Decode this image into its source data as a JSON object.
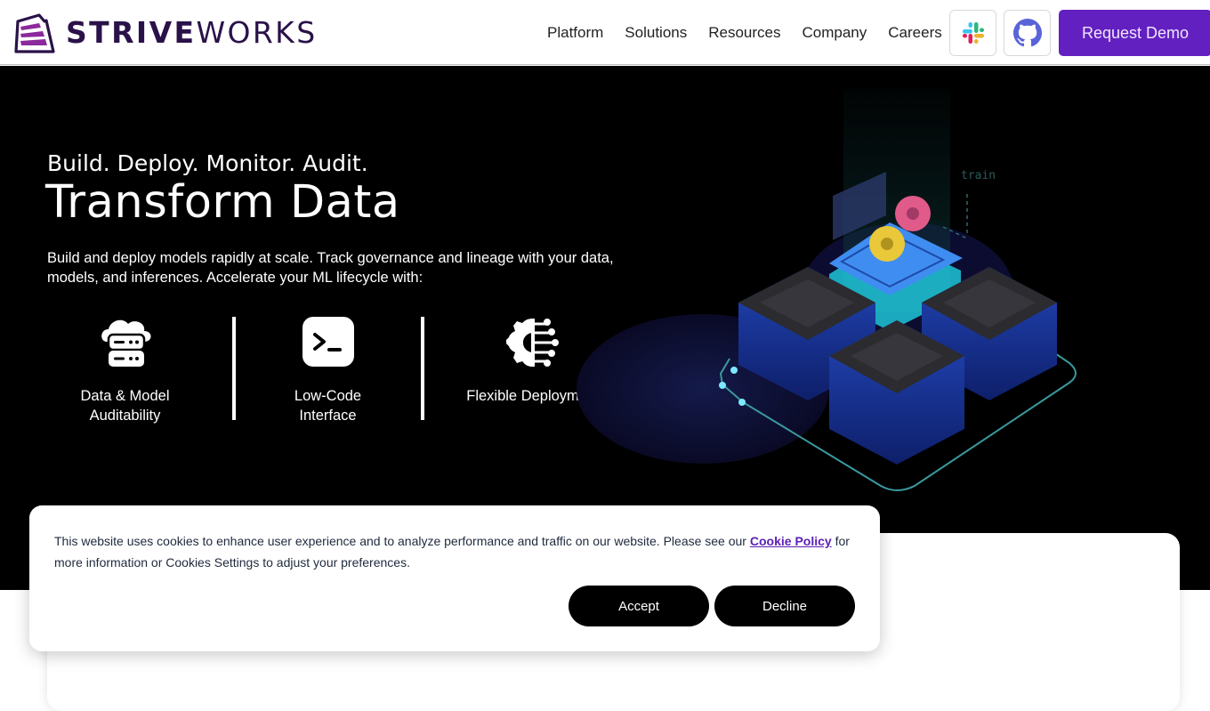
{
  "brand": {
    "name_bold": "STRIVE",
    "name_light": "WORKS",
    "color": "#2a1249",
    "logo_accent": "#8b2a9c"
  },
  "nav": {
    "links": [
      "Platform",
      "Solutions",
      "Resources",
      "Company",
      "Careers"
    ],
    "slack_icon": "slack-icon",
    "github_icon": "github-icon",
    "cta_label": "Request Demo",
    "cta_color": "#6320c0"
  },
  "hero": {
    "eyebrow": "Build. Deploy. Monitor. Audit.",
    "title": "Transform Data",
    "description": "Build and deploy models rapidly at scale. Track governance and lineage with your data, models, and inferences. Accelerate your ML lifecycle with:",
    "features": [
      {
        "icon": "cloud-server-icon",
        "label_line1": "Data & Model",
        "label_line2": "Auditability"
      },
      {
        "icon": "terminal-icon",
        "label_line1": "Low-Code",
        "label_line2": "Interface"
      },
      {
        "icon": "gear-circuit-icon",
        "label_line1": "Flexible Deployment",
        "label_line2": ""
      }
    ],
    "illustration_label": "train"
  },
  "cookie_banner": {
    "text_before": "This website uses cookies to enhance user experience and to analyze performance and traffic on our website. Please see our ",
    "link_text": "Cookie Policy",
    "text_after": " for more information or Cookies Settings to adjust your preferences.",
    "accept_label": "Accept",
    "decline_label": "Decline"
  }
}
